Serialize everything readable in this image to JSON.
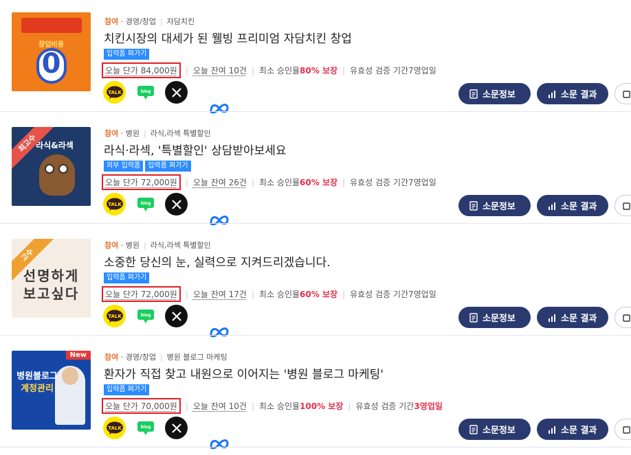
{
  "colors": {
    "accent_orange": "#e8702a",
    "price_border": "#e21e26",
    "highlight": "#e5304d",
    "tag_blue": "#2b8cff",
    "button_navy": "#2a3a6e"
  },
  "labels": {
    "info_button": "소문정보",
    "result_button": "소문 결과",
    "stats_sep": "|"
  },
  "share_icons": [
    "kakaotalk-icon",
    "meta-icon",
    "naver-blog-icon",
    "x-icon"
  ],
  "cards": [
    {
      "join": "참여",
      "category": "경영/창업",
      "subcategory": "자담치킨",
      "title": "치킨시장의 대세가 된 웰빙 프리미엄 자담치킨 창업",
      "tags": [
        "입력폼 펴가기"
      ],
      "price": "오늘 단가 84,000원",
      "remaining": "오늘 잔여 10건",
      "approval_prefix": "최소 승인율 ",
      "approval_value": "80% 보장",
      "validity_prefix": "유효성 검증 기간 ",
      "validity_value": "7영업일",
      "thumb_main": "0",
      "thumb_sub": "창업비용",
      "thumb_brand": "자담치킨"
    },
    {
      "join": "참여",
      "category": "병원",
      "subcategory": "라식,라섹 특별할인",
      "title": "라식·라섹, '특별할인' 상담받아보세요",
      "tags": [
        "외부 입력폼",
        "입력폼 펴가기"
      ],
      "price": "오늘 단가 72,000원",
      "remaining": "오늘 잔여 26건",
      "approval_prefix": "최소 승인율 ",
      "approval_value": "60% 보장",
      "validity_prefix": "유효성 검증 기간 ",
      "validity_value": "7영업일",
      "ribbon": "최고수",
      "thumb_text": "라식&라섹"
    },
    {
      "join": "참여",
      "category": "병원",
      "subcategory": "라식,라섹 특별할인",
      "title": "소중한 당신의 눈, 실력으로 지켜드리겠습니다.",
      "tags": [
        "입력폼 펴가기"
      ],
      "price": "오늘 단가 72,000원",
      "remaining": "오늘 잔여 17건",
      "approval_prefix": "최소 승인율 ",
      "approval_value": "60% 보장",
      "validity_prefix": "유효성 검증 기간 ",
      "validity_value": "7영업일",
      "ribbon": "고수",
      "thumb_line1": "선명하게",
      "thumb_line2": "보고싶다"
    },
    {
      "join": "참여",
      "category": "경영/창업",
      "subcategory": "병원 블로그 마케팅",
      "title": "환자가 직접 찾고 내원으로 이어지는 '병원 블로그 마케팅'",
      "tags": [
        "입력폼 펴가기"
      ],
      "price": "오늘 단가 70,000원",
      "remaining": "오늘 잔여 10건",
      "approval_prefix": "최소 승인율 ",
      "approval_value": "100% 보장",
      "validity_prefix": "유효성 검증 기간 ",
      "validity_value": "3영업일",
      "new_badge": "New",
      "thumb_line1": "병원블로그",
      "thumb_line2": "계정관리"
    }
  ]
}
